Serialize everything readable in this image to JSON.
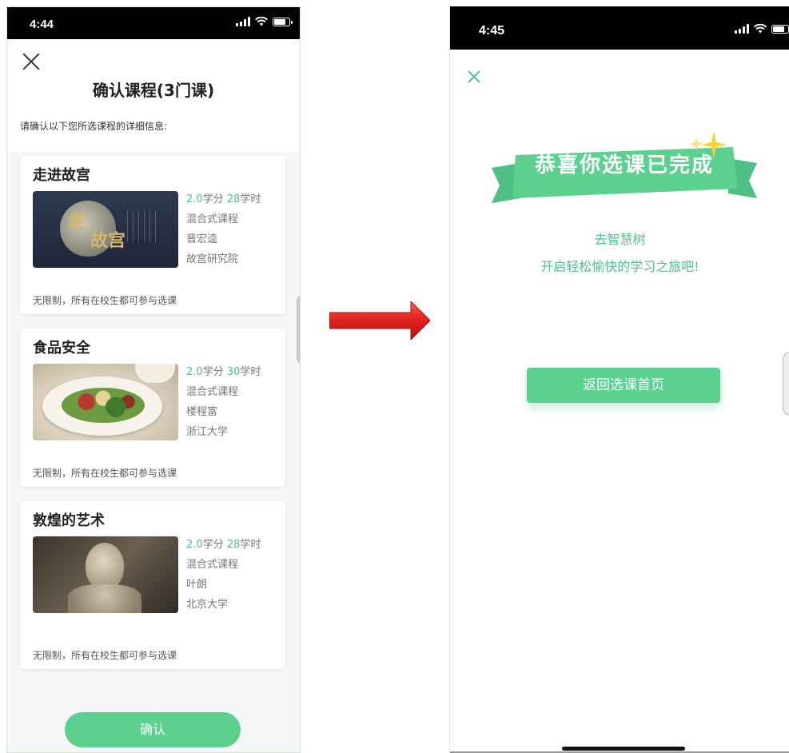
{
  "left_screen": {
    "status_time": "4:44",
    "title": "确认课程(3门课)",
    "subtitle": "请确认以下您所选课程的详细信息:",
    "courses": [
      {
        "name": "走进故宫",
        "credit": "2.0",
        "credit_unit": "学分",
        "hours": "28",
        "hours_unit": "学时",
        "type": "混合式课程",
        "teacher": "晋宏逵",
        "school": "故宫研究院",
        "restriction": "无限制，所有在校生都可参与选课"
      },
      {
        "name": "食品安全",
        "credit": "2.0",
        "credit_unit": "学分",
        "hours": "30",
        "hours_unit": "学时",
        "type": "混合式课程",
        "teacher": "楼程富",
        "school": "浙江大学",
        "restriction": "无限制，所有在校生都可参与选课"
      },
      {
        "name": "敦煌的艺术",
        "credit": "2.0",
        "credit_unit": "学分",
        "hours": "28",
        "hours_unit": "学时",
        "type": "混合式课程",
        "teacher": "叶朗",
        "school": "北京大学",
        "restriction": "无限制，所有在校生都可参与选课"
      }
    ],
    "thumb1_text_a": "走",
    "thumb1_text_b": "故宫",
    "confirm_button": "确认"
  },
  "right_screen": {
    "status_time": "4:45",
    "banner": "恭喜你选课已完成",
    "message_line1": "去智慧树",
    "message_line2": "开启轻松愉快的学习之旅吧!",
    "back_button": "返回选课首页"
  },
  "colors": {
    "accent_green": "#5cd08e",
    "text_green": "#4cc38a",
    "arrow_red": "#e02020"
  },
  "icons": [
    "close-icon",
    "signal-icon",
    "wifi-icon",
    "battery-icon",
    "arrow-right-icon",
    "sparkle-icon"
  ]
}
